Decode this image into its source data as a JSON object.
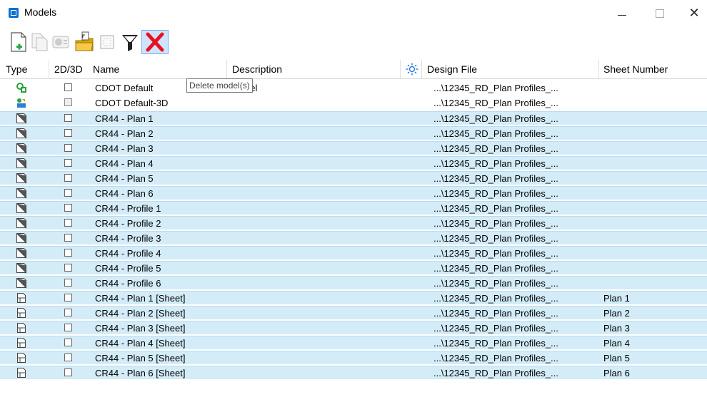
{
  "window": {
    "title": "Models",
    "icon": "models-window-icon"
  },
  "toolbar": {
    "buttons": [
      {
        "name": "create-model",
        "icon": "new-model-icon"
      },
      {
        "name": "copy-model",
        "icon": "copy-model-icon"
      },
      {
        "name": "model-properties",
        "icon": "properties-icon"
      },
      {
        "name": "import-model",
        "icon": "import-folder-icon"
      },
      {
        "name": "select",
        "icon": "select-box-icon"
      },
      {
        "name": "filter",
        "icon": "filter-icon"
      },
      {
        "name": "delete-model",
        "icon": "delete-x-icon"
      }
    ],
    "tooltip": "Delete model(s)"
  },
  "columns": {
    "type": "Type",
    "dim": "2D/3D",
    "name": "Name",
    "description": "Description",
    "design_file": "Design File",
    "sheet_number": "Sheet Number"
  },
  "rows": [
    {
      "type": "design-2d",
      "name": "CDOT Default",
      "description": "Model",
      "file": "...\\12345_RD_Plan Profiles_...",
      "sheet": "",
      "selected": false
    },
    {
      "type": "design-3d",
      "name": "CDOT Default-3D",
      "description": "",
      "file": "...\\12345_RD_Plan Profiles_...",
      "sheet": "",
      "selected": false
    },
    {
      "type": "drawing",
      "name": "CR44 - Plan 1",
      "description": "",
      "file": "...\\12345_RD_Plan Profiles_...",
      "sheet": "",
      "selected": true
    },
    {
      "type": "drawing",
      "name": "CR44 - Plan 2",
      "description": "",
      "file": "...\\12345_RD_Plan Profiles_...",
      "sheet": "",
      "selected": true
    },
    {
      "type": "drawing",
      "name": "CR44 - Plan 3",
      "description": "",
      "file": "...\\12345_RD_Plan Profiles_...",
      "sheet": "",
      "selected": true
    },
    {
      "type": "drawing",
      "name": "CR44 - Plan 4",
      "description": "",
      "file": "...\\12345_RD_Plan Profiles_...",
      "sheet": "",
      "selected": true
    },
    {
      "type": "drawing",
      "name": "CR44 - Plan 5",
      "description": "",
      "file": "...\\12345_RD_Plan Profiles_...",
      "sheet": "",
      "selected": true
    },
    {
      "type": "drawing",
      "name": "CR44 - Plan 6",
      "description": "",
      "file": "...\\12345_RD_Plan Profiles_...",
      "sheet": "",
      "selected": true
    },
    {
      "type": "drawing",
      "name": "CR44 - Profile 1",
      "description": "",
      "file": "...\\12345_RD_Plan Profiles_...",
      "sheet": "",
      "selected": true
    },
    {
      "type": "drawing",
      "name": "CR44 - Profile 2",
      "description": "",
      "file": "...\\12345_RD_Plan Profiles_...",
      "sheet": "",
      "selected": true
    },
    {
      "type": "drawing",
      "name": "CR44 - Profile 3",
      "description": "",
      "file": "...\\12345_RD_Plan Profiles_...",
      "sheet": "",
      "selected": true
    },
    {
      "type": "drawing",
      "name": "CR44 - Profile 4",
      "description": "",
      "file": "...\\12345_RD_Plan Profiles_...",
      "sheet": "",
      "selected": true
    },
    {
      "type": "drawing",
      "name": "CR44 - Profile 5",
      "description": "",
      "file": "...\\12345_RD_Plan Profiles_...",
      "sheet": "",
      "selected": true
    },
    {
      "type": "drawing",
      "name": "CR44 - Profile 6",
      "description": "",
      "file": "...\\12345_RD_Plan Profiles_...",
      "sheet": "",
      "selected": true
    },
    {
      "type": "sheet",
      "name": "CR44 - Plan 1 [Sheet]",
      "description": "",
      "file": "...\\12345_RD_Plan Profiles_...",
      "sheet": "Plan 1",
      "selected": true
    },
    {
      "type": "sheet",
      "name": "CR44 - Plan 2 [Sheet]",
      "description": "",
      "file": "...\\12345_RD_Plan Profiles_...",
      "sheet": "Plan 2",
      "selected": true
    },
    {
      "type": "sheet",
      "name": "CR44 - Plan 3 [Sheet]",
      "description": "",
      "file": "...\\12345_RD_Plan Profiles_...",
      "sheet": "Plan 3",
      "selected": true
    },
    {
      "type": "sheet",
      "name": "CR44 - Plan 4 [Sheet]",
      "description": "",
      "file": "...\\12345_RD_Plan Profiles_...",
      "sheet": "Plan 4",
      "selected": true
    },
    {
      "type": "sheet",
      "name": "CR44 - Plan 5 [Sheet]",
      "description": "",
      "file": "...\\12345_RD_Plan Profiles_...",
      "sheet": "Plan 5",
      "selected": true
    },
    {
      "type": "sheet",
      "name": "CR44 - Plan 6 [Sheet]",
      "description": "",
      "file": "...\\12345_RD_Plan Profiles_...",
      "sheet": "Plan 6",
      "selected": true
    }
  ],
  "colors": {
    "selected_row": "#d3ecf7",
    "selected_border": "#b9dcf0",
    "delete_red": "#e81123",
    "accent_blue": "#0a6fd0"
  }
}
